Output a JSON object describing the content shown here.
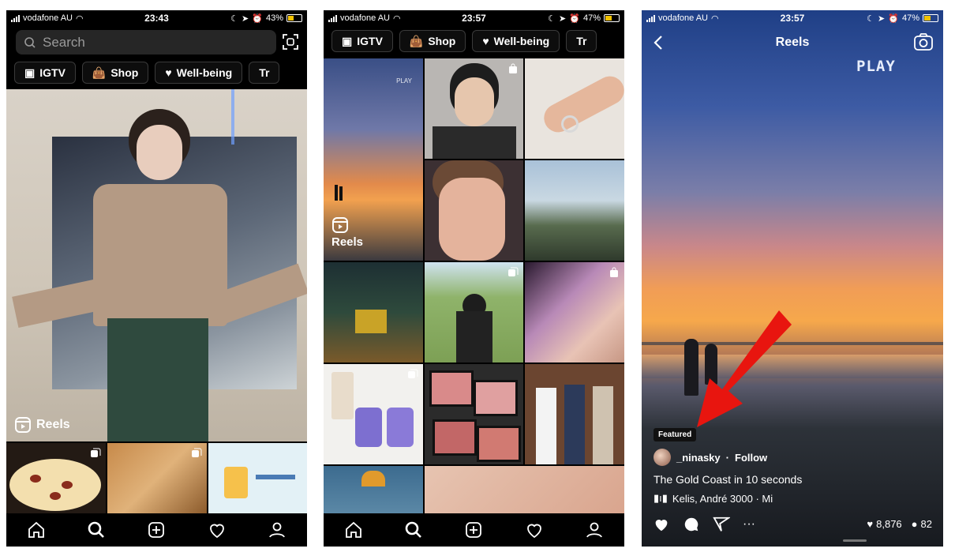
{
  "status_bars": [
    {
      "carrier": "vodafone AU",
      "time": "23:43",
      "battery": "43%",
      "battery_level": 0.43
    },
    {
      "carrier": "vodafone AU",
      "time": "23:57",
      "battery": "47%",
      "battery_level": 0.47
    },
    {
      "carrier": "vodafone AU",
      "time": "23:57",
      "battery": "47%",
      "battery_level": 0.47
    }
  ],
  "explore": {
    "search_placeholder": "Search",
    "chips": [
      "IGTV",
      "Shop",
      "Well-being",
      "Tr"
    ],
    "reels_label": "Reels"
  },
  "explore2": {
    "chips": [
      "IGTV",
      "Shop",
      "Well-being",
      "Tr"
    ],
    "reels_label": "Reels",
    "play_text": "PLAY"
  },
  "reel": {
    "title": "Reels",
    "play_text": "PLAY",
    "featured": "Featured",
    "username": "_ninasky",
    "separator": "·",
    "follow": "Follow",
    "caption": "The Gold Coast in 10 seconds",
    "audio": "Kelis, André 3000 · Mi",
    "likes": "8,876",
    "comments": "82"
  },
  "colors": {
    "arrow": "#e8150f",
    "accent": "#ffffff",
    "bar": "#000000"
  }
}
